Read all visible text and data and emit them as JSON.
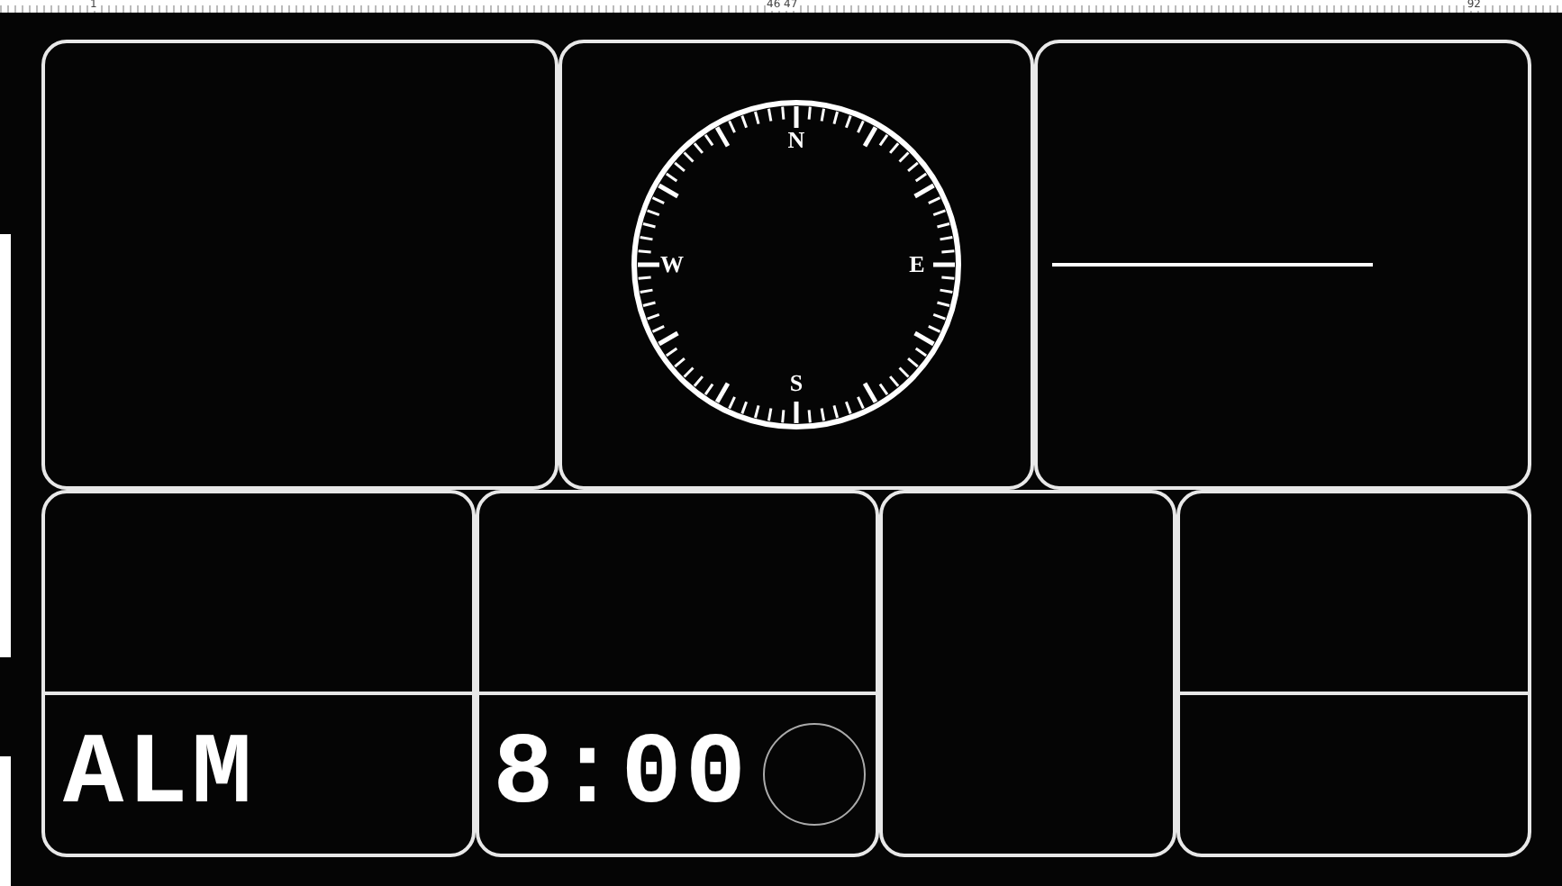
{
  "ruler": {
    "labels": [
      "1",
      "46 47",
      "92"
    ]
  },
  "compass": {
    "labels": [
      "N",
      "E",
      "S",
      "W"
    ]
  },
  "alarm": {
    "label": "ALM",
    "time": "8:00"
  }
}
